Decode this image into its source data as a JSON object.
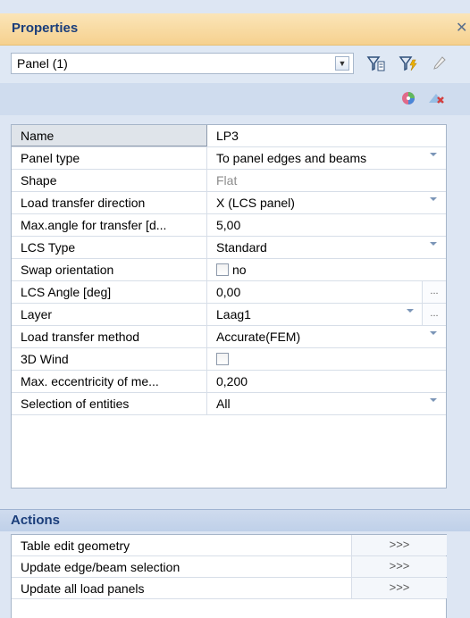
{
  "panel": {
    "title": "Properties",
    "close_glyph": "✕"
  },
  "selector": {
    "value": "Panel (1)"
  },
  "toolbar_icons": [
    "filter-select-icon",
    "filter-lightning-icon",
    "pencil-icon"
  ],
  "icon_row": [
    "color-palette-icon",
    "remove-color-icon"
  ],
  "grid": {
    "rows": [
      {
        "name": "Name",
        "value": "LP3"
      },
      {
        "name": "Panel type",
        "value": "To panel edges and beams"
      },
      {
        "name": "Shape",
        "value": "Flat"
      },
      {
        "name": "Load transfer direction",
        "value": "X (LCS panel)"
      },
      {
        "name": "Max.angle for transfer [d...",
        "value": "5,00"
      },
      {
        "name": "LCS Type",
        "value": "Standard"
      },
      {
        "name": "Swap orientation",
        "value": "no"
      },
      {
        "name": "LCS Angle [deg]",
        "value": "0,00"
      },
      {
        "name": "Layer",
        "value": "Laag1"
      },
      {
        "name": "Load transfer method",
        "value": "Accurate(FEM)"
      },
      {
        "name": "3D Wind",
        "value": ""
      },
      {
        "name": "Max. eccentricity of me...",
        "value": "0,200"
      },
      {
        "name": "Selection of entities",
        "value": "All"
      }
    ],
    "ellipsis": "..."
  },
  "actions": {
    "title": "Actions",
    "go_label": ">>>",
    "items": [
      {
        "label": "Table edit geometry"
      },
      {
        "label": "Update edge/beam selection"
      },
      {
        "label": "Update all load panels"
      }
    ]
  },
  "colors": {
    "header_bg": "#f6d18f",
    "title_text": "#1a3d7a",
    "panel_bg": "#dde6f3"
  }
}
